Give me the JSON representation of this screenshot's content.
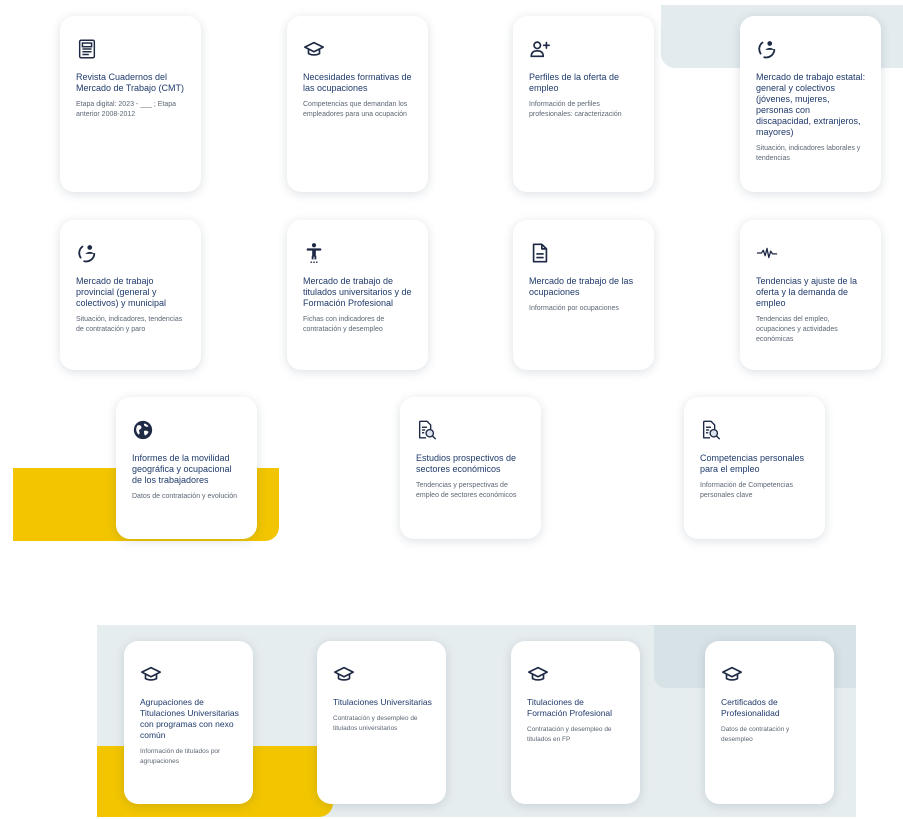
{
  "colors": {
    "accent_yellow": "#f2c500",
    "panel_gray": "#e6edef",
    "text_title": "#1f3a6b",
    "text_desc": "#5c6674"
  },
  "top_cards": [
    {
      "icon": "newspaper-icon",
      "title": "Revista Cuadernos del Mercado de Trabajo (CMT)",
      "desc": "Etapa digital: 2023 - ___ ; Etapa anterior 2008-2012"
    },
    {
      "icon": "graduation-cap-icon",
      "title": "Necesidades formativas de las ocupaciones",
      "desc": "Competencias que demandan los empleadores para una ocupación"
    },
    {
      "icon": "person-add-icon",
      "title": "Perfiles de la oferta de empleo",
      "desc": "Información de perfiles profesionales: caracterización"
    },
    {
      "icon": "person-cycle-icon",
      "title": "Mercado de trabajo estatal: general y colectivos (jóvenes, mujeres, personas con discapacidad, extranjeros, mayores)",
      "desc": "Situación, indicadores laborales y tendencias"
    },
    {
      "icon": "person-cycle-icon",
      "title": "Mercado de trabajo provincial (general y colectivos) y municipal",
      "desc": "Situación, indicadores, tendencias de contratación y paro"
    },
    {
      "icon": "person-figure-icon",
      "title": "Mercado de trabajo de titulados universitarios y de Formación Profesional",
      "desc": "Fichas con indicadores de contratación y desempleo"
    },
    {
      "icon": "document-icon",
      "title": "Mercado de trabajo de las ocupaciones",
      "desc": "Información por ocupaciones"
    },
    {
      "icon": "pulse-icon",
      "title": "Tendencias y ajuste de la oferta y la demanda de empleo",
      "desc": "Tendencias del empleo, ocupaciones y actividades económicas"
    },
    {
      "icon": "globe-icon",
      "title": "Informes de la movilidad geográfica y ocupacional de los trabajadores",
      "desc": "Datos de contratación y evolución"
    },
    {
      "icon": "document-search-icon",
      "title": "Estudios prospectivos de sectores económicos",
      "desc": "Tendencias y perspectivas de empleo de sectores económicos"
    },
    {
      "icon": "document-search-icon",
      "title": "Competencias personales para el empleo",
      "desc": "Información de Competencias personales clave"
    }
  ],
  "bottom_cards": [
    {
      "icon": "graduation-cap-icon",
      "title": "Agrupaciones de Titulaciones Universitarias con programas con nexo común",
      "desc": "Información de titulados por agrupaciones"
    },
    {
      "icon": "graduation-cap-icon",
      "title": "Titulaciones Universitarias",
      "desc": "Contratación y desempleo de titulados universitarios"
    },
    {
      "icon": "graduation-cap-icon",
      "title": "Titulaciones de Formación Profesional",
      "desc": "Contratación y desempleo de titulados en FP"
    },
    {
      "icon": "graduation-cap-icon",
      "title": "Certificados de Profesionalidad",
      "desc": "Datos de contratación y desempleo"
    }
  ]
}
